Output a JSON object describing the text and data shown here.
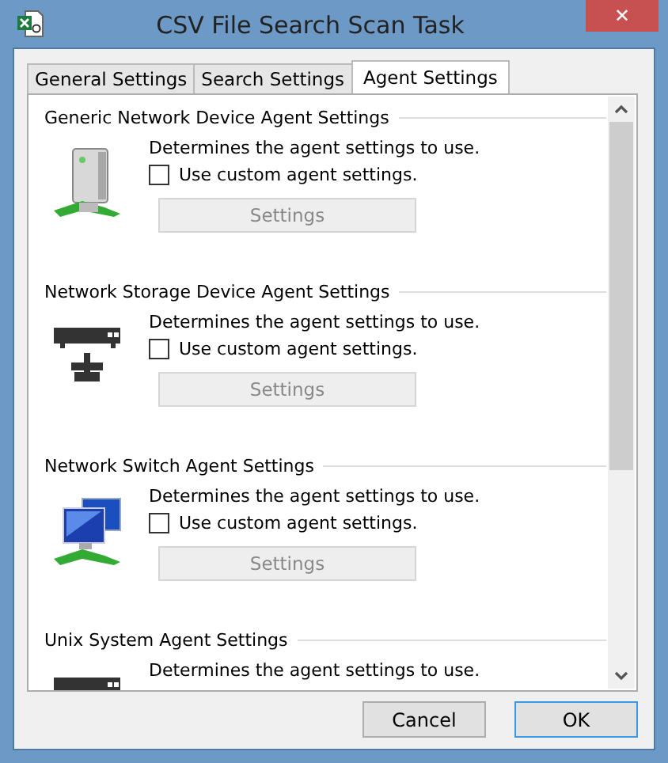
{
  "window": {
    "title": "CSV File Search Scan Task",
    "close": "✕"
  },
  "tabs": [
    {
      "label": "General Settings",
      "selected": false
    },
    {
      "label": "Search Settings",
      "selected": false
    },
    {
      "label": "Agent Settings",
      "selected": true
    }
  ],
  "sections": [
    {
      "title": "Generic Network Device Agent Settings",
      "kind": "server",
      "description": "Determines the agent settings to use.",
      "checkbox": {
        "label": "Use custom agent settings.",
        "checked": false
      },
      "button": "Settings"
    },
    {
      "title": "Network Storage Device Agent Settings",
      "kind": "storage",
      "description": "Determines the agent settings to use.",
      "checkbox": {
        "label": "Use custom agent settings.",
        "checked": false
      },
      "button": "Settings"
    },
    {
      "title": "Network Switch Agent Settings",
      "kind": "switch",
      "description": "Determines the agent settings to use.",
      "checkbox": {
        "label": "Use custom agent settings.",
        "checked": false
      },
      "button": "Settings"
    },
    {
      "title": "Unix System Agent Settings",
      "kind": "unix",
      "description": "Determines the agent settings to use."
    }
  ],
  "buttons": [
    {
      "label": "Cancel",
      "default": false
    },
    {
      "label": "OK",
      "default": true
    }
  ]
}
